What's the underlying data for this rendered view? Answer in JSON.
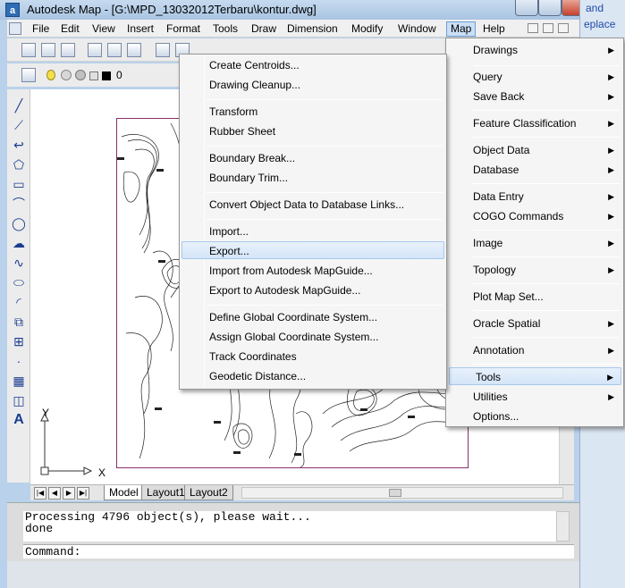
{
  "window": {
    "title": "Autodesk Map - [G:\\MPD_13032012Terbaru\\kontur.dwg]",
    "app_icon_letter": "a",
    "side_text_1": "and",
    "side_text_2": "eplace"
  },
  "menubar": {
    "items": [
      "File",
      "Edit",
      "View",
      "Insert",
      "Format",
      "Tools",
      "Draw",
      "Dimension",
      "Modify",
      "Window",
      "Map",
      "Help"
    ],
    "active": "Map"
  },
  "layer": {
    "current": "0"
  },
  "map_menu": {
    "items": [
      {
        "label": "Drawings",
        "submenu": true
      },
      {
        "label": "Query",
        "submenu": true
      },
      {
        "label": "Save Back",
        "submenu": true
      },
      {
        "label": "Feature Classification",
        "submenu": true
      },
      {
        "label": "Object Data",
        "submenu": true
      },
      {
        "label": "Database",
        "submenu": true
      },
      {
        "label": "Data Entry",
        "submenu": true
      },
      {
        "label": "COGO Commands",
        "submenu": true
      },
      {
        "label": "Image",
        "submenu": true
      },
      {
        "label": "Topology",
        "submenu": true
      },
      {
        "label": "Plot Map Set...",
        "submenu": false
      },
      {
        "label": "Oracle Spatial",
        "submenu": true
      },
      {
        "label": "Annotation",
        "submenu": true
      },
      {
        "label": "Tools",
        "submenu": true
      },
      {
        "label": "Utilities",
        "submenu": true
      },
      {
        "label": "Options...",
        "submenu": false
      }
    ],
    "highlighted": "Tools"
  },
  "tools_submenu": {
    "items": [
      {
        "label": "Create Centroids..."
      },
      {
        "label": "Drawing Cleanup..."
      },
      {
        "label": "Transform"
      },
      {
        "label": "Rubber Sheet"
      },
      {
        "label": "Boundary Break..."
      },
      {
        "label": "Boundary Trim..."
      },
      {
        "label": "Convert Object Data to Database Links..."
      },
      {
        "label": "Import..."
      },
      {
        "label": "Export..."
      },
      {
        "label": "Import from Autodesk MapGuide..."
      },
      {
        "label": "Export to Autodesk MapGuide..."
      },
      {
        "label": "Define Global Coordinate System..."
      },
      {
        "label": "Assign Global Coordinate System..."
      },
      {
        "label": "Track Coordinates"
      },
      {
        "label": "Geodetic Distance..."
      }
    ],
    "highlighted": "Export..."
  },
  "layout_tabs": [
    "Model",
    "Layout1",
    "Layout2"
  ],
  "active_tab": "Model",
  "ucs": {
    "x_label": "X",
    "y_label": "Y"
  },
  "command": {
    "history": [
      "Processing 4796 object(s), please wait...",
      "done"
    ],
    "prompt": "Command:"
  },
  "colors": {
    "menu_highlight": "#d4e5f8",
    "paper_border": "#8a2f6e",
    "title_bar": "#b9d1ea"
  }
}
